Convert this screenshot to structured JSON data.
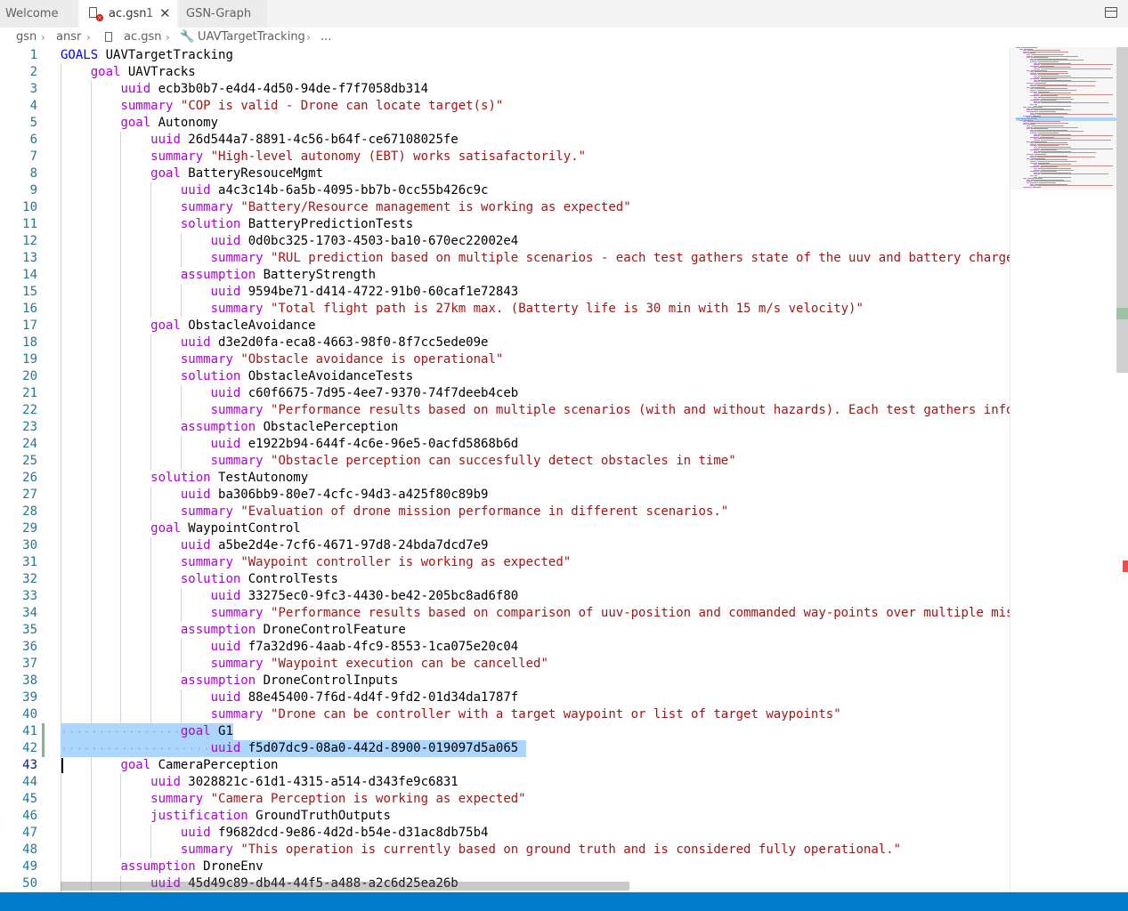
{
  "tabs": [
    {
      "label": "Welcome"
    },
    {
      "label": "ac.gsn",
      "problems": "1",
      "close": "✕"
    },
    {
      "label": "GSN-Graph"
    }
  ],
  "breadcrumb": {
    "items": [
      "gsn",
      "ansr",
      "ac.gsn",
      "UAVTargetTracking",
      "..."
    ],
    "separator": "›"
  },
  "editor": {
    "current_line": 43,
    "lines": [
      {
        "n": "1",
        "kw": "GOALS",
        "rest": " UAVTargetTracking"
      },
      {
        "n": "2",
        "kw": "goal",
        "rest": " UAVTracks"
      },
      {
        "n": "3",
        "kw": "uuid",
        "rest": " ecb3b0b7-e4d4-4d50-94de-f7f7058db314"
      },
      {
        "n": "4",
        "kw": "summary",
        "str": "\"COP is valid - Drone can locate target(s)\""
      },
      {
        "n": "5",
        "kw": "goal",
        "rest": " Autonomy"
      },
      {
        "n": "6",
        "kw": "uuid",
        "rest": " 26d544a7-8891-4c56-b64f-ce67108025fe"
      },
      {
        "n": "7",
        "kw": "summary",
        "str": "\"High-level autonomy (EBT) works satisafactorily.\""
      },
      {
        "n": "8",
        "kw": "goal",
        "rest": " BatteryResouceMgmt"
      },
      {
        "n": "9",
        "kw": "uuid",
        "rest": " a4c3c14b-6a5b-4095-bb7b-0cc55b426c9c"
      },
      {
        "n": "10",
        "kw": "summary",
        "str": "\"Battery/Resource management is working as expected\""
      },
      {
        "n": "11",
        "kw": "solution",
        "rest": " BatteryPredictionTests"
      },
      {
        "n": "12",
        "kw": "uuid",
        "rest": " 0d0bc325-1703-4503-ba10-670ec22002e4"
      },
      {
        "n": "13",
        "kw": "summary",
        "str": "\"RUL prediction based on multiple scenarios - each test gathers state of the uuv and battery charge"
      },
      {
        "n": "14",
        "kw": "assumption",
        "rest": " BatteryStrength"
      },
      {
        "n": "15",
        "kw": "uuid",
        "rest": " 9594be71-d414-4722-91b0-60caf1e72843"
      },
      {
        "n": "16",
        "kw": "summary",
        "str": "\"Total flight path is 27km max. (Batterty life is 30 min with 15 m/s velocity)\""
      },
      {
        "n": "17",
        "kw": "goal",
        "rest": " ObstacleAvoidance"
      },
      {
        "n": "18",
        "kw": "uuid",
        "rest": " d3e2d0fa-eca8-4663-98f0-8f7cc5ede09e"
      },
      {
        "n": "19",
        "kw": "summary",
        "str": "\"Obstacle avoidance is operational\""
      },
      {
        "n": "20",
        "kw": "solution",
        "rest": " ObstacleAvoidanceTests"
      },
      {
        "n": "21",
        "kw": "uuid",
        "rest": " c60f6675-7d95-4ee7-9370-74f7deeb4ceb"
      },
      {
        "n": "22",
        "kw": "summary",
        "str": "\"Performance results based on multiple scenarios (with and without hazards). Each test gathers info"
      },
      {
        "n": "23",
        "kw": "assumption",
        "rest": " ObstaclePerception"
      },
      {
        "n": "24",
        "kw": "uuid",
        "rest": " e1922b94-644f-4c6e-96e5-0acfd5868b6d"
      },
      {
        "n": "25",
        "kw": "summary",
        "str": "\"Obstacle perception can succesfully detect obstacles in time\""
      },
      {
        "n": "26",
        "kw": "solution",
        "rest": " TestAutonomy"
      },
      {
        "n": "27",
        "kw": "uuid",
        "rest": " ba306bb9-80e7-4cfc-94d3-a425f80c89b9"
      },
      {
        "n": "28",
        "kw": "summary",
        "str": "\"Evaluation of drone mission performance in different scenarios.\""
      },
      {
        "n": "29",
        "kw": "goal",
        "rest": " WaypointControl"
      },
      {
        "n": "30",
        "kw": "uuid",
        "rest": " a5be2d4e-7cf6-4671-97d8-24bda7dcd7e9"
      },
      {
        "n": "31",
        "kw": "summary",
        "str": "\"Waypoint controller is working as expected\""
      },
      {
        "n": "32",
        "kw": "solution",
        "rest": " ControlTests"
      },
      {
        "n": "33",
        "kw": "uuid",
        "rest": " 33275ec0-9fc3-4430-be42-205bc8ad6f80"
      },
      {
        "n": "34",
        "kw": "summary",
        "str": "\"Performance results based on comparison of uuv-position and commanded way-points over multiple mis"
      },
      {
        "n": "35",
        "kw": "assumption",
        "rest": " DroneControlFeature"
      },
      {
        "n": "36",
        "kw": "uuid",
        "rest": " f7a32d96-4aab-4fc9-8553-1ca075e20c04"
      },
      {
        "n": "37",
        "kw": "summary",
        "str": "\"Waypoint execution can be cancelled\""
      },
      {
        "n": "38",
        "kw": "assumption",
        "rest": " DroneControlInputs"
      },
      {
        "n": "39",
        "kw": "uuid",
        "rest": " 88e45400-7f6d-4d4f-9fd2-01d34da1787f"
      },
      {
        "n": "40",
        "kw": "summary",
        "str": "\"Drone can be controller with a target waypoint or list of target waypoints\""
      },
      {
        "n": "41",
        "kw": "goal",
        "rest": " G1"
      },
      {
        "n": "42",
        "kw": "uuid",
        "rest": " f5d07dc9-08a0-442d-8900-019097d5a065"
      },
      {
        "n": "43",
        "kw": "goal",
        "rest": " CameraPerception"
      },
      {
        "n": "44",
        "kw": "uuid",
        "rest": " 3028821c-61d1-4315-a514-d343fe9c6831"
      },
      {
        "n": "45",
        "kw": "summary",
        "str": "\"Camera Perception is working as expected\""
      },
      {
        "n": "46",
        "kw": "justification",
        "rest": " GroundTruthOutputs"
      },
      {
        "n": "47",
        "kw": "uuid",
        "rest": " f9682dcd-9e86-4d2d-b54e-d31ac8db75b4"
      },
      {
        "n": "48",
        "kw": "summary",
        "str": "\"This operation is currently based on ground truth and is considered fully operational.\""
      },
      {
        "n": "49",
        "kw": "assumption",
        "rest": " DroneEnv"
      },
      {
        "n": "50",
        "kw": "uuid",
        "rest": " 45d49c89-db44-44f5-a488-a2c6d25ea26b"
      }
    ]
  },
  "colors": {
    "keyword": "#af00db",
    "keyword_root": "#0000ff",
    "string": "#a31515",
    "line_number": "#237893",
    "selection": "#add6ff",
    "status_bar": "#007acc"
  }
}
